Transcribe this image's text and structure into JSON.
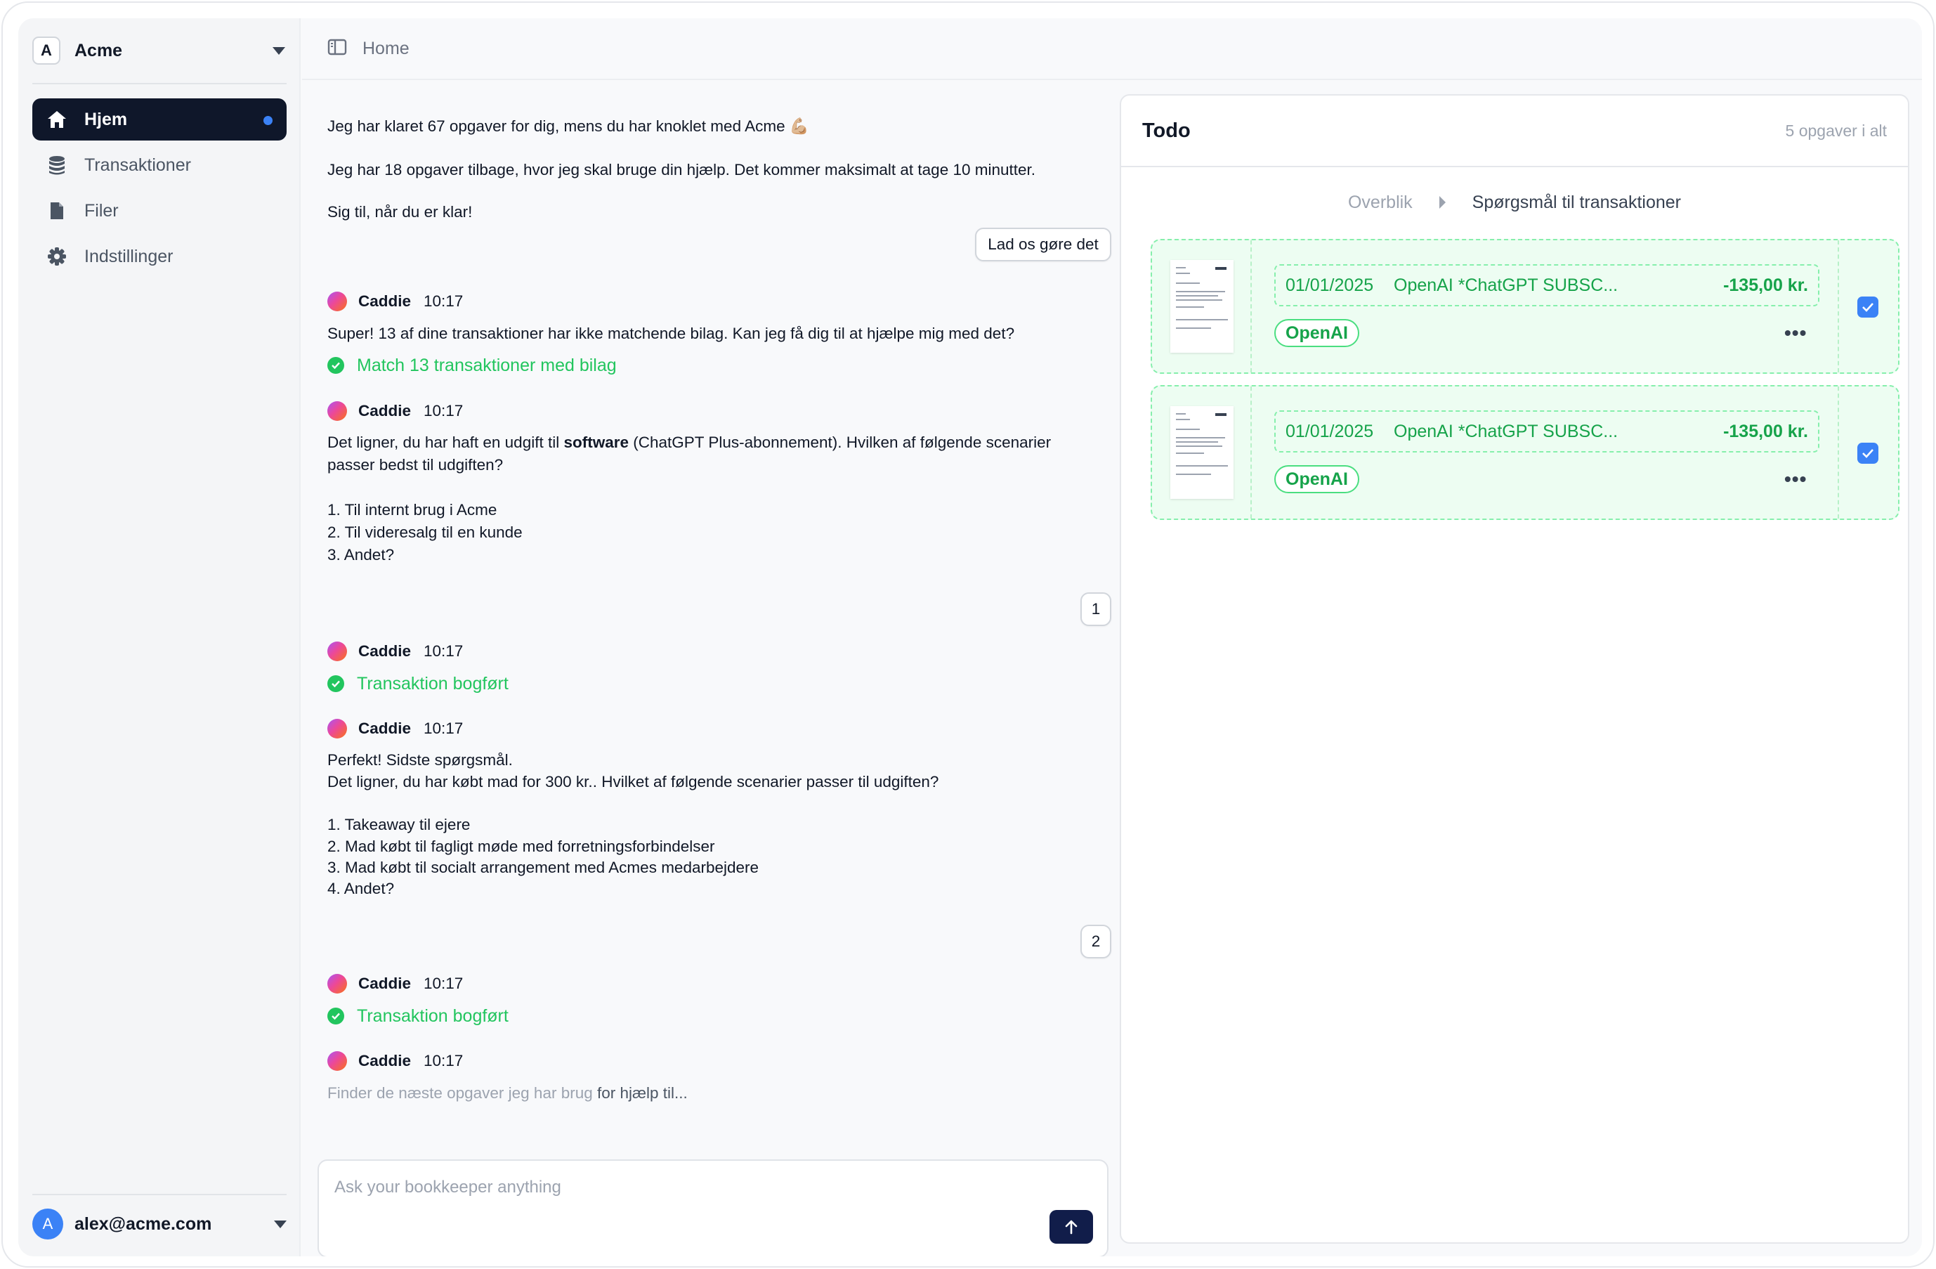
{
  "workspace": {
    "logo_letter": "A",
    "name": "Acme"
  },
  "sidebar": {
    "items": [
      {
        "label": "Hjem",
        "icon": "home-icon",
        "active": true
      },
      {
        "label": "Transaktioner",
        "icon": "coins-icon"
      },
      {
        "label": "Filer",
        "icon": "file-icon"
      },
      {
        "label": "Indstillinger",
        "icon": "gear-icon"
      }
    ]
  },
  "user": {
    "avatar_letter": "A",
    "email": "alex@acme.com"
  },
  "header": {
    "breadcrumb": "Home",
    "icon": "sidebar-toggle-icon"
  },
  "chat": {
    "intro": [
      "Jeg har klaret 67 opgaver for dig, mens du har knoklet med Acme 💪🏼",
      "Jeg har 18 opgaver tilbage, hvor jeg skal bruge din hjælp. Det kommer maksimalt at tage 10 minutter.",
      "Sig til, når du er klar!"
    ],
    "reply_button": "Lad os gøre det",
    "bot_name": "Caddie",
    "time": "10:17",
    "m1_text": "Super! 13 af dine transaktioner har ikke matchende bilag. Kan jeg få dig til at hjælpe mig med det?",
    "m1_action": "Match 13 transaktioner med bilag",
    "m2_pre": "Det ligner, du har haft en udgift til ",
    "m2_bold": "software",
    "m2_post": " (ChatGPT Plus-abonnement). Hvilken af følgende scenarier",
    "m2_line2": "passer bedst til udgiften?",
    "m2_options": [
      "1. Til internt brug i Acme",
      "2. Til videresalg til en kunde",
      "3. Andet?"
    ],
    "reply_1": "1",
    "m3_action": "Transaktion bogført",
    "m4_line1": "Perfekt! Sidste spørgsmål.",
    "m4_line2": "Det ligner, du har købt mad for 300 kr.. Hvilket af følgende scenarier passer til udgiften?",
    "m4_options": [
      "1. Takeaway til ejere",
      "2. Mad købt til fagligt møde med forretningsforbindelser",
      "3. Mad købt til socialt arrangement med Acmes medarbejdere",
      "4. Andet?"
    ],
    "reply_2": "2",
    "m5_action": "Transaktion bogført",
    "m6_faded": "Finder de næste opgaver jeg har brug ",
    "m6_dark": "for hjælp til...",
    "composer_placeholder": "Ask your bookkeeper anything"
  },
  "todo": {
    "title": "Todo",
    "count": "5 opgaver i alt",
    "tab_overview": "Overblik",
    "tab_current": "Spørgsmål til transaktioner",
    "cards": [
      {
        "date": "01/01/2025",
        "description": "OpenAI *ChatGPT SUBSC...",
        "amount": "-135,00 kr.",
        "vendor": "OpenAI",
        "checked": true
      },
      {
        "date": "01/01/2025",
        "description": "OpenAI *ChatGPT SUBSC...",
        "amount": "-135,00 kr.",
        "vendor": "OpenAI",
        "checked": true
      }
    ]
  },
  "colors": {
    "accent": "#3b82f6",
    "success": "#22c55e",
    "nav_active": "#0f172a",
    "send_button": "#111d4a"
  }
}
